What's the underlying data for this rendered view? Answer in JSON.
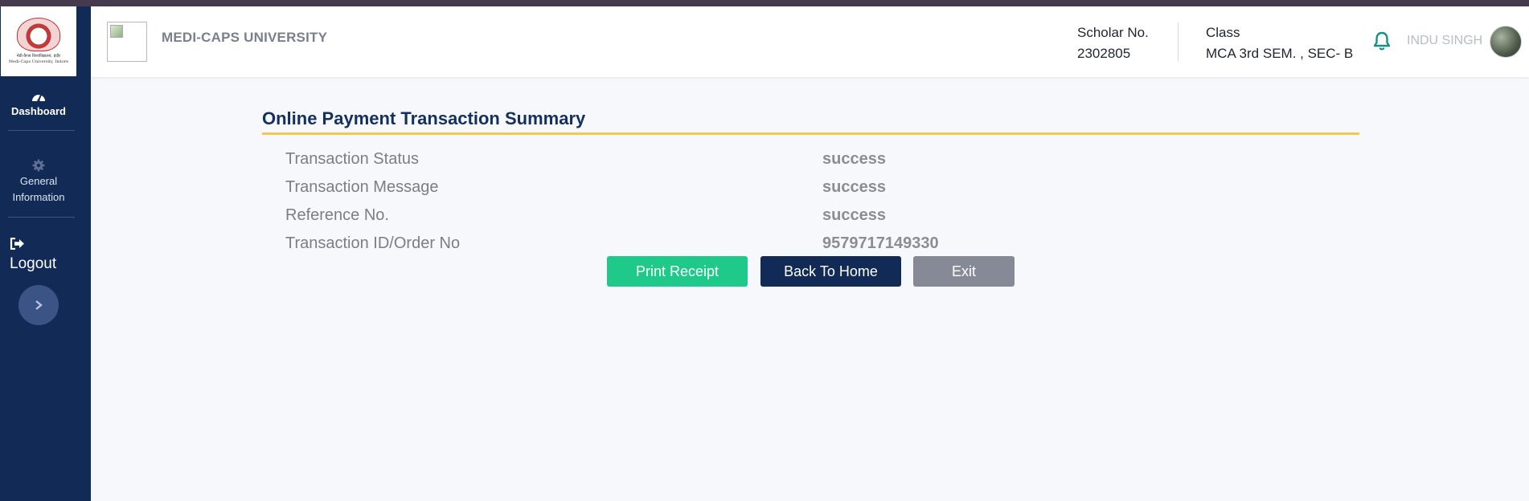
{
  "sidebar": {
    "logo_text": "मेडी-कैप्स विश्वविद्यालय, इंदौर\nMedi-Caps University, Indore",
    "items": [
      {
        "label": "Dashboard",
        "icon": "gauge-icon"
      },
      {
        "label": "General Information",
        "icon": "gear-icon"
      },
      {
        "label": "Logout",
        "icon": "logout-icon"
      }
    ],
    "toggle_icon": "chevron-right-icon"
  },
  "header": {
    "brand": "MEDI-CAPS UNIVERSITY",
    "scholar_label": "Scholar No.",
    "scholar_value": "2302805",
    "class_label": "Class",
    "class_value": "MCA 3rd SEM. , SEC- B",
    "notification_icon": "bell-icon",
    "user_name": "INDU SINGH"
  },
  "main": {
    "title": "Online Payment Transaction Summary",
    "rows": [
      {
        "label": "Transaction Status",
        "value": "success"
      },
      {
        "label": "Transaction Message",
        "value": "success"
      },
      {
        "label": "Reference No.",
        "value": "success"
      },
      {
        "label": "Transaction ID/Order No",
        "value": "9579717149330"
      }
    ],
    "buttons": {
      "print": "Print Receipt",
      "home": "Back To Home",
      "exit": "Exit"
    }
  },
  "colors": {
    "sidebar_bg": "#122a56",
    "accent_rule": "#f2c94c",
    "title": "#14305e",
    "print_button": "#1ec98a",
    "home_button": "#122a56",
    "exit_button": "#868a96",
    "bell": "#1a8f86"
  }
}
